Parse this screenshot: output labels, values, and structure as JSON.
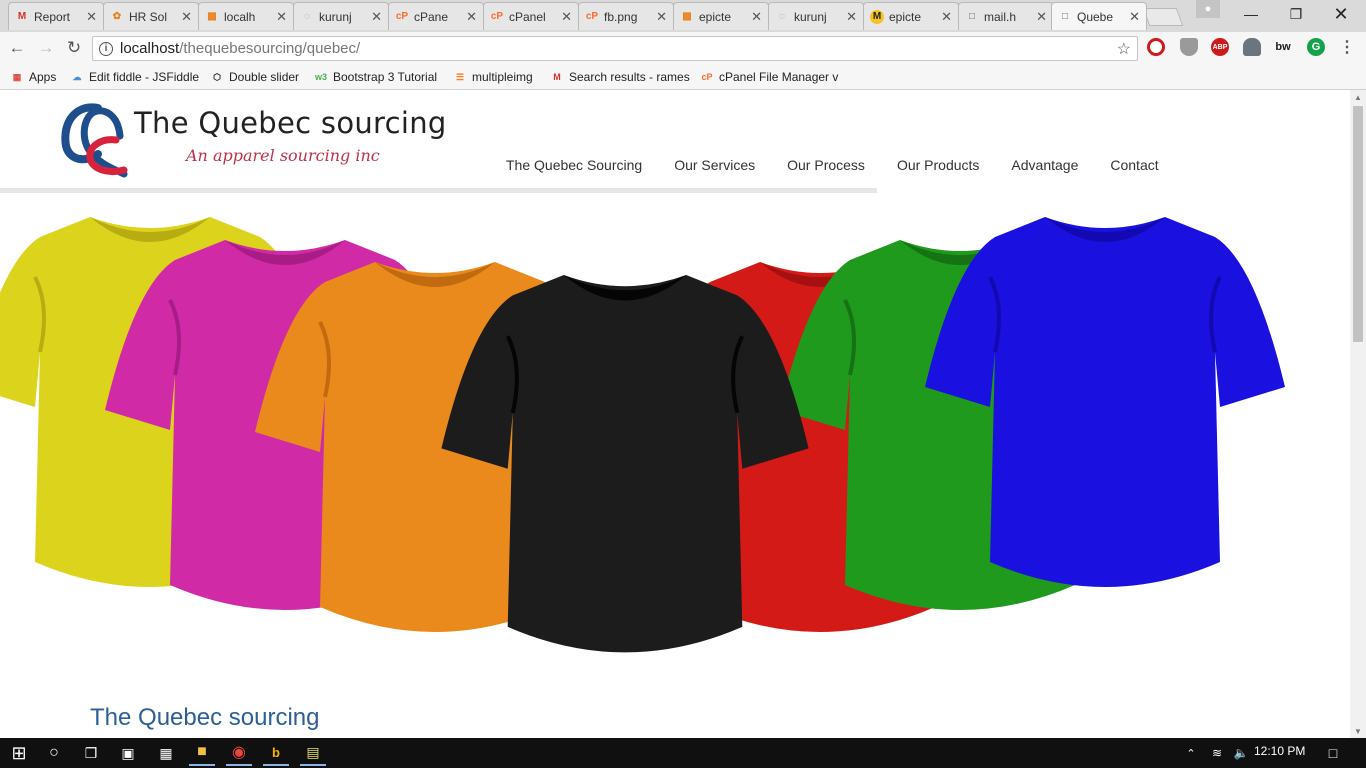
{
  "browser": {
    "tabs": [
      {
        "label": "Report",
        "icon": "gmail-icon"
      },
      {
        "label": "HR Sol",
        "icon": "hr-icon"
      },
      {
        "label": "localh",
        "icon": "phpmyadmin-icon"
      },
      {
        "label": "kurunj",
        "icon": "loading-icon"
      },
      {
        "label": "cPane",
        "icon": "cpanel-icon"
      },
      {
        "label": "cPanel",
        "icon": "cpanel-icon"
      },
      {
        "label": "fb.png",
        "icon": "cpanel-icon"
      },
      {
        "label": "epicte",
        "icon": "phpmyadmin-icon"
      },
      {
        "label": "kurunj",
        "icon": "loading-icon"
      },
      {
        "label": "epicte",
        "icon": "m-icon"
      },
      {
        "label": "mail.h",
        "icon": "page-icon"
      },
      {
        "label": "Quebe",
        "icon": "page-icon",
        "active": true
      }
    ],
    "url_host": "localhost",
    "url_path": "/thequebesourcing/quebec/",
    "bookmarks": [
      {
        "label": "Apps",
        "icon": "apps-icon"
      },
      {
        "label": "Edit fiddle - JSFiddle",
        "icon": "jsfiddle-icon"
      },
      {
        "label": "Double slider",
        "icon": "codepen-icon"
      },
      {
        "label": "Bootstrap 3 Tutorial",
        "icon": "w3-icon"
      },
      {
        "label": "multipleimg",
        "icon": "stackoverflow-icon"
      },
      {
        "label": "Search results - rames",
        "icon": "gmail-icon"
      },
      {
        "label": "cPanel File Manager v",
        "icon": "cpanel-icon"
      }
    ],
    "extensions": [
      "opera-icon",
      "shield-icon",
      "adblock-icon",
      "ghostery-icon",
      "bw-icon",
      "grammarly-icon"
    ],
    "ext_labels": {
      "adblock": "ABP",
      "bw": "bw",
      "grammarly": "G"
    }
  },
  "site": {
    "title": "The Quebec sourcing",
    "tagline": "An apparel sourcing inc",
    "nav": [
      "The Quebec Sourcing",
      "Our Services",
      "Our Process",
      "Our Products",
      "Advantage",
      "Contact"
    ],
    "section_heading": "The Quebec sourcing",
    "hero_shirts": [
      {
        "color": "#dcd41c",
        "shade": "#b7ad12"
      },
      {
        "color": "#d02aa6",
        "shade": "#a81c85"
      },
      {
        "color": "#ea8a1c",
        "shade": "#c26a10"
      },
      {
        "color": "#d41a16",
        "shade": "#a51010"
      },
      {
        "color": "#1f9a1d",
        "shade": "#157314"
      },
      {
        "color": "#1a10e0",
        "shade": "#120ab0"
      },
      {
        "color": "#1c1c1c",
        "shade": "#050505"
      }
    ]
  },
  "taskbar": {
    "clock": "12:10 PM",
    "icons": [
      "windows-start-icon",
      "cortana-icon",
      "task-view-icon",
      "store-icon",
      "app-icon",
      "file-explorer-icon",
      "chrome-icon",
      "bing-icon",
      "notepad-icon"
    ]
  }
}
